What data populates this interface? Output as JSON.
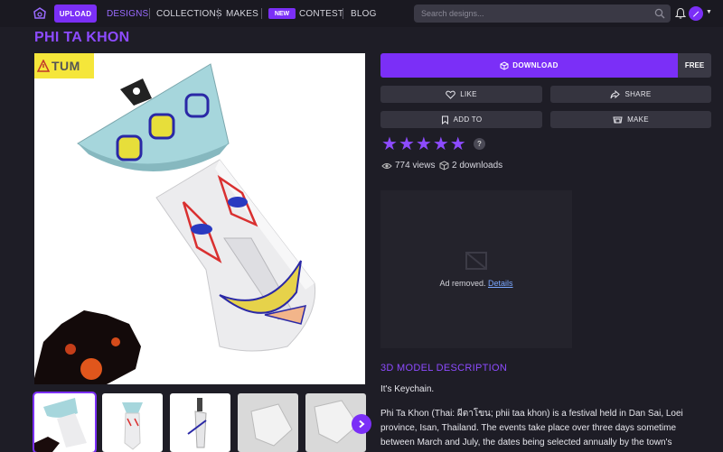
{
  "nav": {
    "upload_label": "UPLOAD",
    "links": [
      "DESIGNS",
      "COLLECTIONS",
      "MAKES",
      "CONTEST",
      "BLOG"
    ],
    "new_badge": "NEW",
    "search_placeholder": "Search designs...",
    "icons": [
      "logo-icon",
      "search-icon",
      "bell-icon",
      "avatar",
      "caret-down-icon"
    ]
  },
  "page": {
    "title": "PHI TA KHON",
    "watermark": "TUM"
  },
  "actions": {
    "download_label": "DOWNLOAD",
    "free_label": "FREE",
    "like_label": "LIKE",
    "share_label": "SHARE",
    "add_to_label": "ADD TO",
    "make_label": "MAKE"
  },
  "rating": {
    "stars": 5,
    "help": "?"
  },
  "stats": {
    "views": "774 views",
    "downloads": "2 downloads"
  },
  "ad": {
    "text": "Ad removed.",
    "link": "Details"
  },
  "description": {
    "heading": "3D MODEL DESCRIPTION",
    "line1": "It's Keychain.",
    "body": "Phi Ta Khon (Thai: ผีตาโขน; phii taa khon) is a festival held in Dan Sai, Loei province, Isan, Thailand. The events take place over three days sometime between March and July, the dates being selected annually by the town's mediums."
  },
  "colors": {
    "accent": "#7b2ff7",
    "title": "#8d4bff",
    "background": "#1e1d26"
  }
}
